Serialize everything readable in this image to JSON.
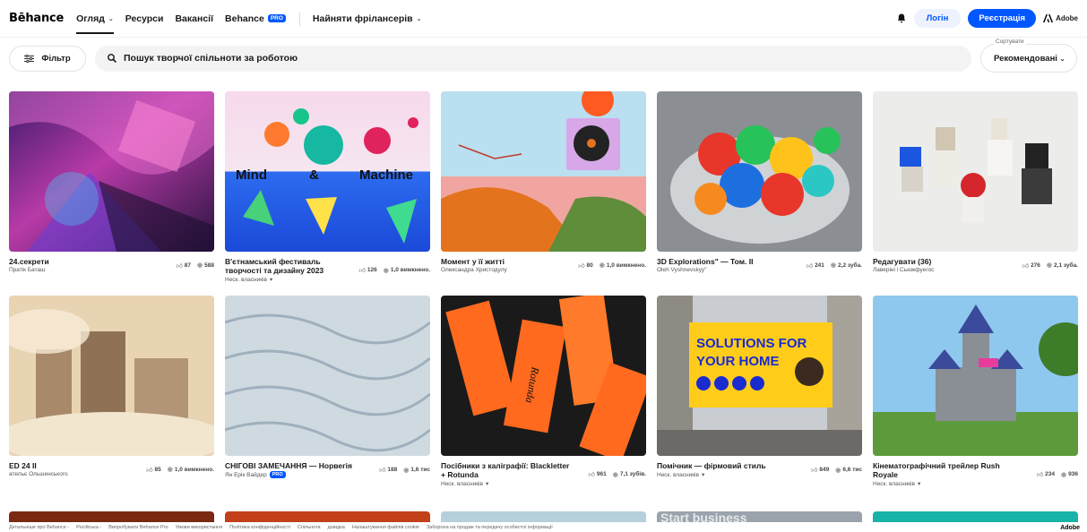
{
  "nav": {
    "logo": "Bēhance",
    "explore": "Огляд",
    "assets": "Ресурси",
    "jobs": "Вакансії",
    "behance_pro": "Behance",
    "pro_badge": "PRO",
    "hire": "Найняти фрілансерів",
    "login": "Логін",
    "signup": "Реєстрація",
    "adobe": "Adobe"
  },
  "search": {
    "filter_label": "Фільтр",
    "placeholder": "Пошук творчої спільноти за роботою",
    "sort_caption": "Сортувати",
    "sort_value": "Рекомендовані"
  },
  "projects": [
    {
      "title": "24.секрети",
      "owner": "Пратік Баташ",
      "likes": "87",
      "views": "588"
    },
    {
      "title": "В'єтнамський фестиваль творчості та дизайну 2023",
      "owner": "Неск. власників",
      "likes": "126",
      "views": "1,0 вимкнено."
    },
    {
      "title": "Момент у її житті",
      "owner": "Олександра Христодулу",
      "likes": "80",
      "views": "1,0 вимкнено."
    },
    {
      "title": "3D Explorations\" — Том. II",
      "owner": "Oleh Vyshnevskyy\"",
      "likes": "241",
      "views": "2,2 зуба."
    },
    {
      "title": "Редагувати (36)",
      "owner": "Лаверіні і Сьюжфуегос",
      "likes": "276",
      "views": "2,1 зуба."
    },
    {
      "title": "ED 24 II",
      "owner": "ательє Ольшенського",
      "likes": "85",
      "views": "1,0 вимкнено."
    },
    {
      "title": "СНІГОВІ ЗАМЕЧАННЯ — Норвегія",
      "owner": "Ян Ерік Вайдер",
      "likes": "188",
      "views": "1,6 тис",
      "pro": "PRO"
    },
    {
      "title": "Посібники з каліграфії: Blackletter + Rotunda",
      "owner": "Неск. власників",
      "likes": "961",
      "views": "7,1 зубів."
    },
    {
      "title": "Помічник — фірмовий стиль",
      "owner": "Неск. власників",
      "likes": "849",
      "views": "6,6 тис"
    },
    {
      "title": "Кінематографічний трейлер Rush Royale",
      "owner": "Неск. власників",
      "likes": "234",
      "views": "936"
    }
  ],
  "thumb_text": {
    "mind": "Mind",
    "amp": "&",
    "machine": "Machine",
    "billboard_1": "SOLUTIONS FOR",
    "billboard_2": "YOUR HOME",
    "rotunda": "Rotunda",
    "partial": "Start business"
  },
  "footer": {
    "links": [
      "Детальніше про Behance -",
      "Російська -",
      "Випробувати Behance Pro",
      "Умови використання",
      "Політика конфіденційності",
      "Спільнота",
      "довідка",
      "Налаштування файлів cookie",
      "Заборона на продаж та передачу особистої інформації"
    ],
    "adobe": "Adobe"
  },
  "colors": {
    "brand_blue": "#0057ff"
  }
}
